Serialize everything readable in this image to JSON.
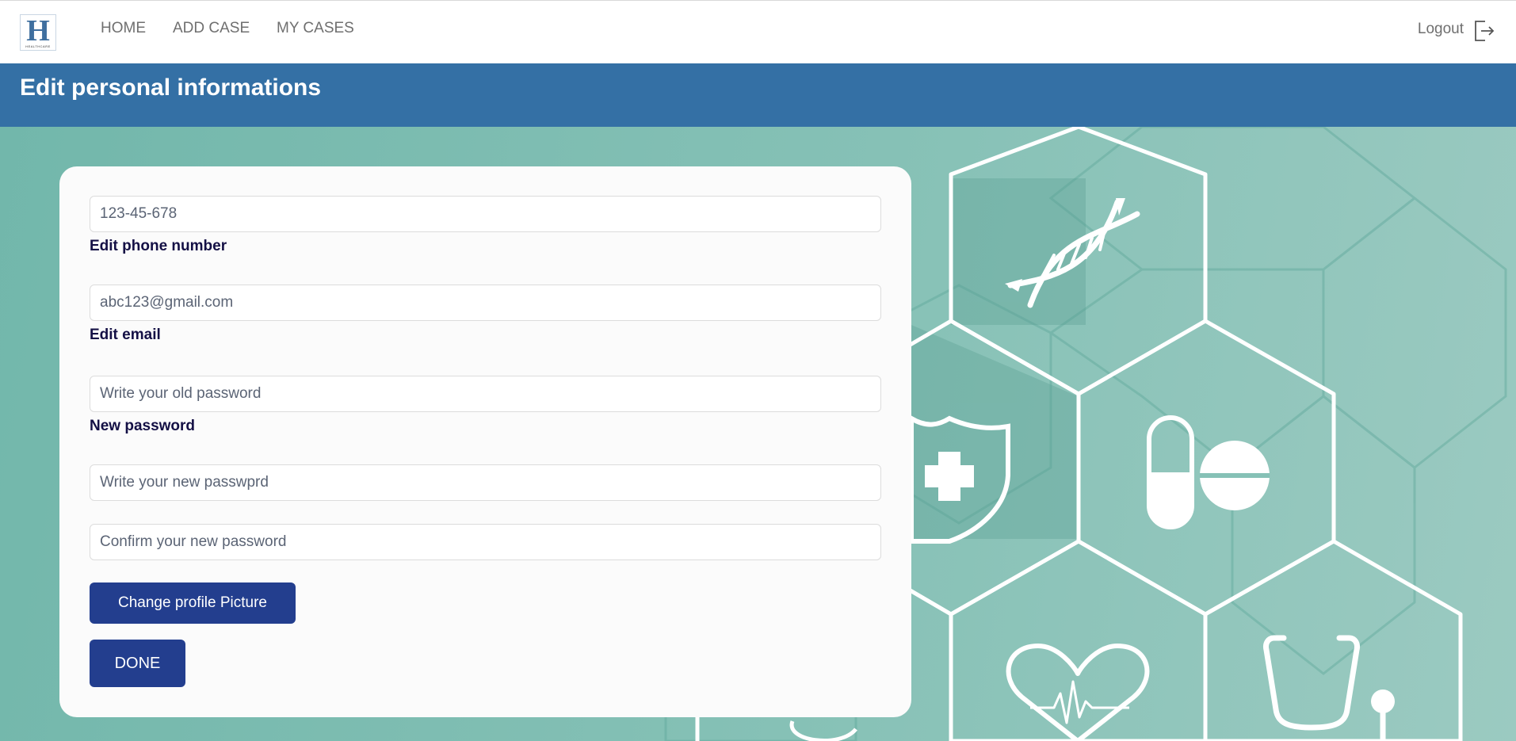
{
  "brand": {
    "logo_letter": "H",
    "logo_tagline": "HEALTHCARE"
  },
  "nav": {
    "items": [
      {
        "label": "HOME"
      },
      {
        "label": "ADD CASE"
      },
      {
        "label": "MY CASES"
      }
    ],
    "logout_label": "Logout"
  },
  "page": {
    "title": "Edit personal informations"
  },
  "form": {
    "phone": {
      "value": "123-45-678",
      "label": "Edit phone number"
    },
    "email": {
      "value": "abc123@gmail.com",
      "label": "Edit email"
    },
    "old_password": {
      "placeholder": "Write your old password",
      "label": "New password"
    },
    "new_password": {
      "placeholder": "Write your new passwprd"
    },
    "confirm_password": {
      "placeholder": "Confirm your new password"
    },
    "change_picture_label": "Change profile Picture",
    "done_label": "DONE"
  },
  "colors": {
    "navbar": "#ffffff",
    "banner": "#3470a5",
    "button": "#233e8e",
    "label_text": "#141045",
    "background_teal": "#7fbcb3"
  },
  "background_icons": [
    "dna-icon",
    "shield-cross-icon",
    "pill-icon",
    "tablet-icon",
    "heart-pulse-icon",
    "stethoscope-icon"
  ]
}
